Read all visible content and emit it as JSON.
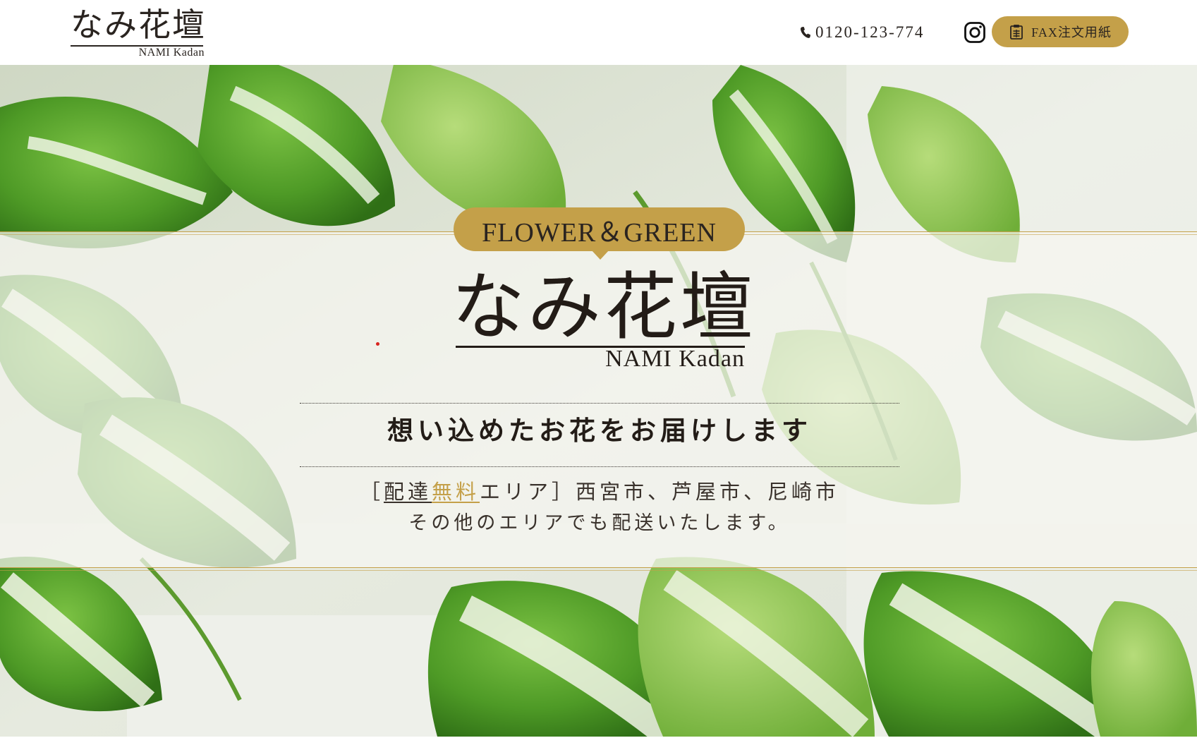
{
  "header": {
    "logo": {
      "jp": "なみ花壇",
      "en": "NAMI  Kadan"
    },
    "phone": {
      "icon": "phone-icon",
      "number": "0120-123-774"
    },
    "instagram": {
      "icon": "instagram-icon"
    },
    "fax_button": {
      "icon": "clipboard-icon",
      "label": "FAX注文用紙"
    }
  },
  "hero": {
    "background": "green-and-white pothos leaves photo",
    "tag": "FLOWER＆GREEN",
    "logo": {
      "jp": "なみ花壇",
      "en": "NAMI  Kadan"
    },
    "tagline": "想い込めたお花をお届けします",
    "area": {
      "open_bracket": "［",
      "delivery": "配達",
      "free": "無料",
      "rest": "エリア］西宮市、芦屋市、尼崎市",
      "line2": "その他のエリアでも配送いたします。"
    }
  },
  "colors": {
    "gold": "#c4a049",
    "text": "#2a2420",
    "band": "#f6f6f0",
    "red_dot": "#d8241f"
  }
}
